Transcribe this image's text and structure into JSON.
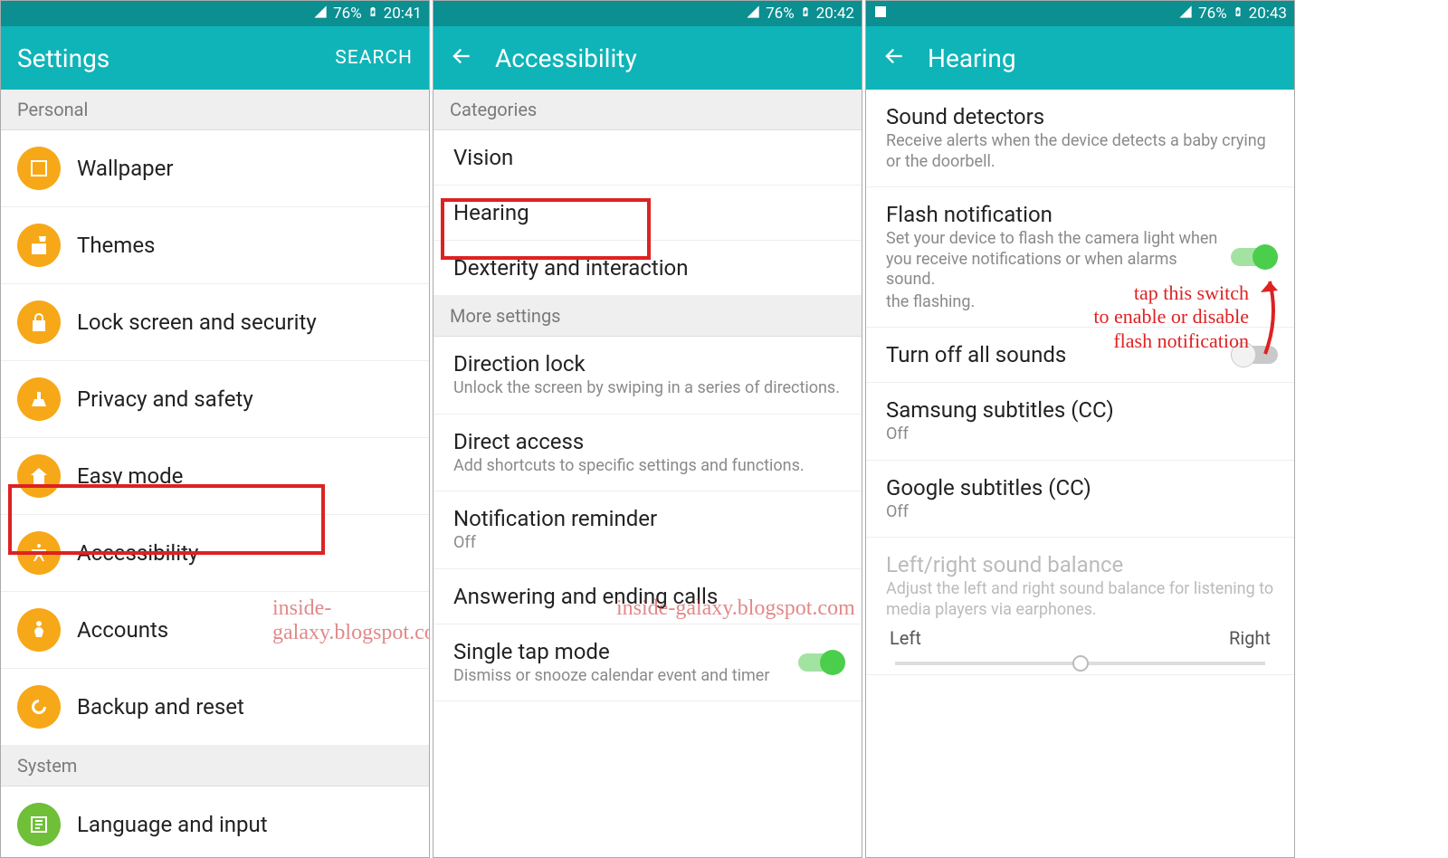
{
  "watermarks": [
    "inside-galaxy.blogspot.com",
    "inside-galaxy.blogspot.com"
  ],
  "screen1": {
    "status": {
      "battery": "76%",
      "time": "20:41"
    },
    "title": "Settings",
    "search": "SEARCH",
    "sections": {
      "personal": "Personal",
      "system": "System"
    },
    "items": [
      {
        "icon": "wallpaper",
        "label": "Wallpaper"
      },
      {
        "icon": "themes",
        "label": "Themes"
      },
      {
        "icon": "lock",
        "label": "Lock screen and security"
      },
      {
        "icon": "privacy",
        "label": "Privacy and safety"
      },
      {
        "icon": "easy",
        "label": "Easy mode"
      },
      {
        "icon": "accessibility",
        "label": "Accessibility"
      },
      {
        "icon": "accounts",
        "label": "Accounts"
      },
      {
        "icon": "backup",
        "label": "Backup and reset"
      }
    ],
    "system_item": {
      "icon": "language",
      "label": "Language and input"
    }
  },
  "screen2": {
    "status": {
      "battery": "76%",
      "time": "20:42"
    },
    "title": "Accessibility",
    "sections": {
      "categories": "Categories",
      "more": "More settings"
    },
    "cats": [
      "Vision",
      "Hearing",
      "Dexterity and interaction"
    ],
    "more": [
      {
        "title": "Direction lock",
        "sub": "Unlock the screen by swiping in a series of directions."
      },
      {
        "title": "Direct access",
        "sub": "Add shortcuts to specific settings and functions."
      },
      {
        "title": "Notification reminder",
        "sub": "Off"
      },
      {
        "title": "Answering and ending calls",
        "sub": ""
      },
      {
        "title": "Single tap mode",
        "sub": "Dismiss or snooze calendar event and timer",
        "switch": "on"
      }
    ]
  },
  "screen3": {
    "status": {
      "battery": "76%",
      "time": "20:43",
      "hasImageIcon": true
    },
    "title": "Hearing",
    "items": [
      {
        "title": "Sound detectors",
        "sub": "Receive alerts when the device detects a baby crying or the doorbell."
      },
      {
        "title": "Flash notification",
        "sub": "Set your device to flash the camera light when you receive notifications or when alarms sound.",
        "sub2": "the flashing.",
        "switch": "on"
      },
      {
        "title": "Turn off all sounds",
        "switch": "off"
      },
      {
        "title": "Samsung subtitles (CC)",
        "sub": "Off"
      },
      {
        "title": "Google subtitles (CC)",
        "sub": "Off"
      },
      {
        "title": "Left/right sound balance",
        "sub": "Adjust the left and right sound balance for listening to media players via earphones.",
        "disabled": true
      }
    ],
    "slider": {
      "left": "Left",
      "right": "Right"
    },
    "annotation": "tap this switch\nto enable or disable\nflash notification"
  }
}
